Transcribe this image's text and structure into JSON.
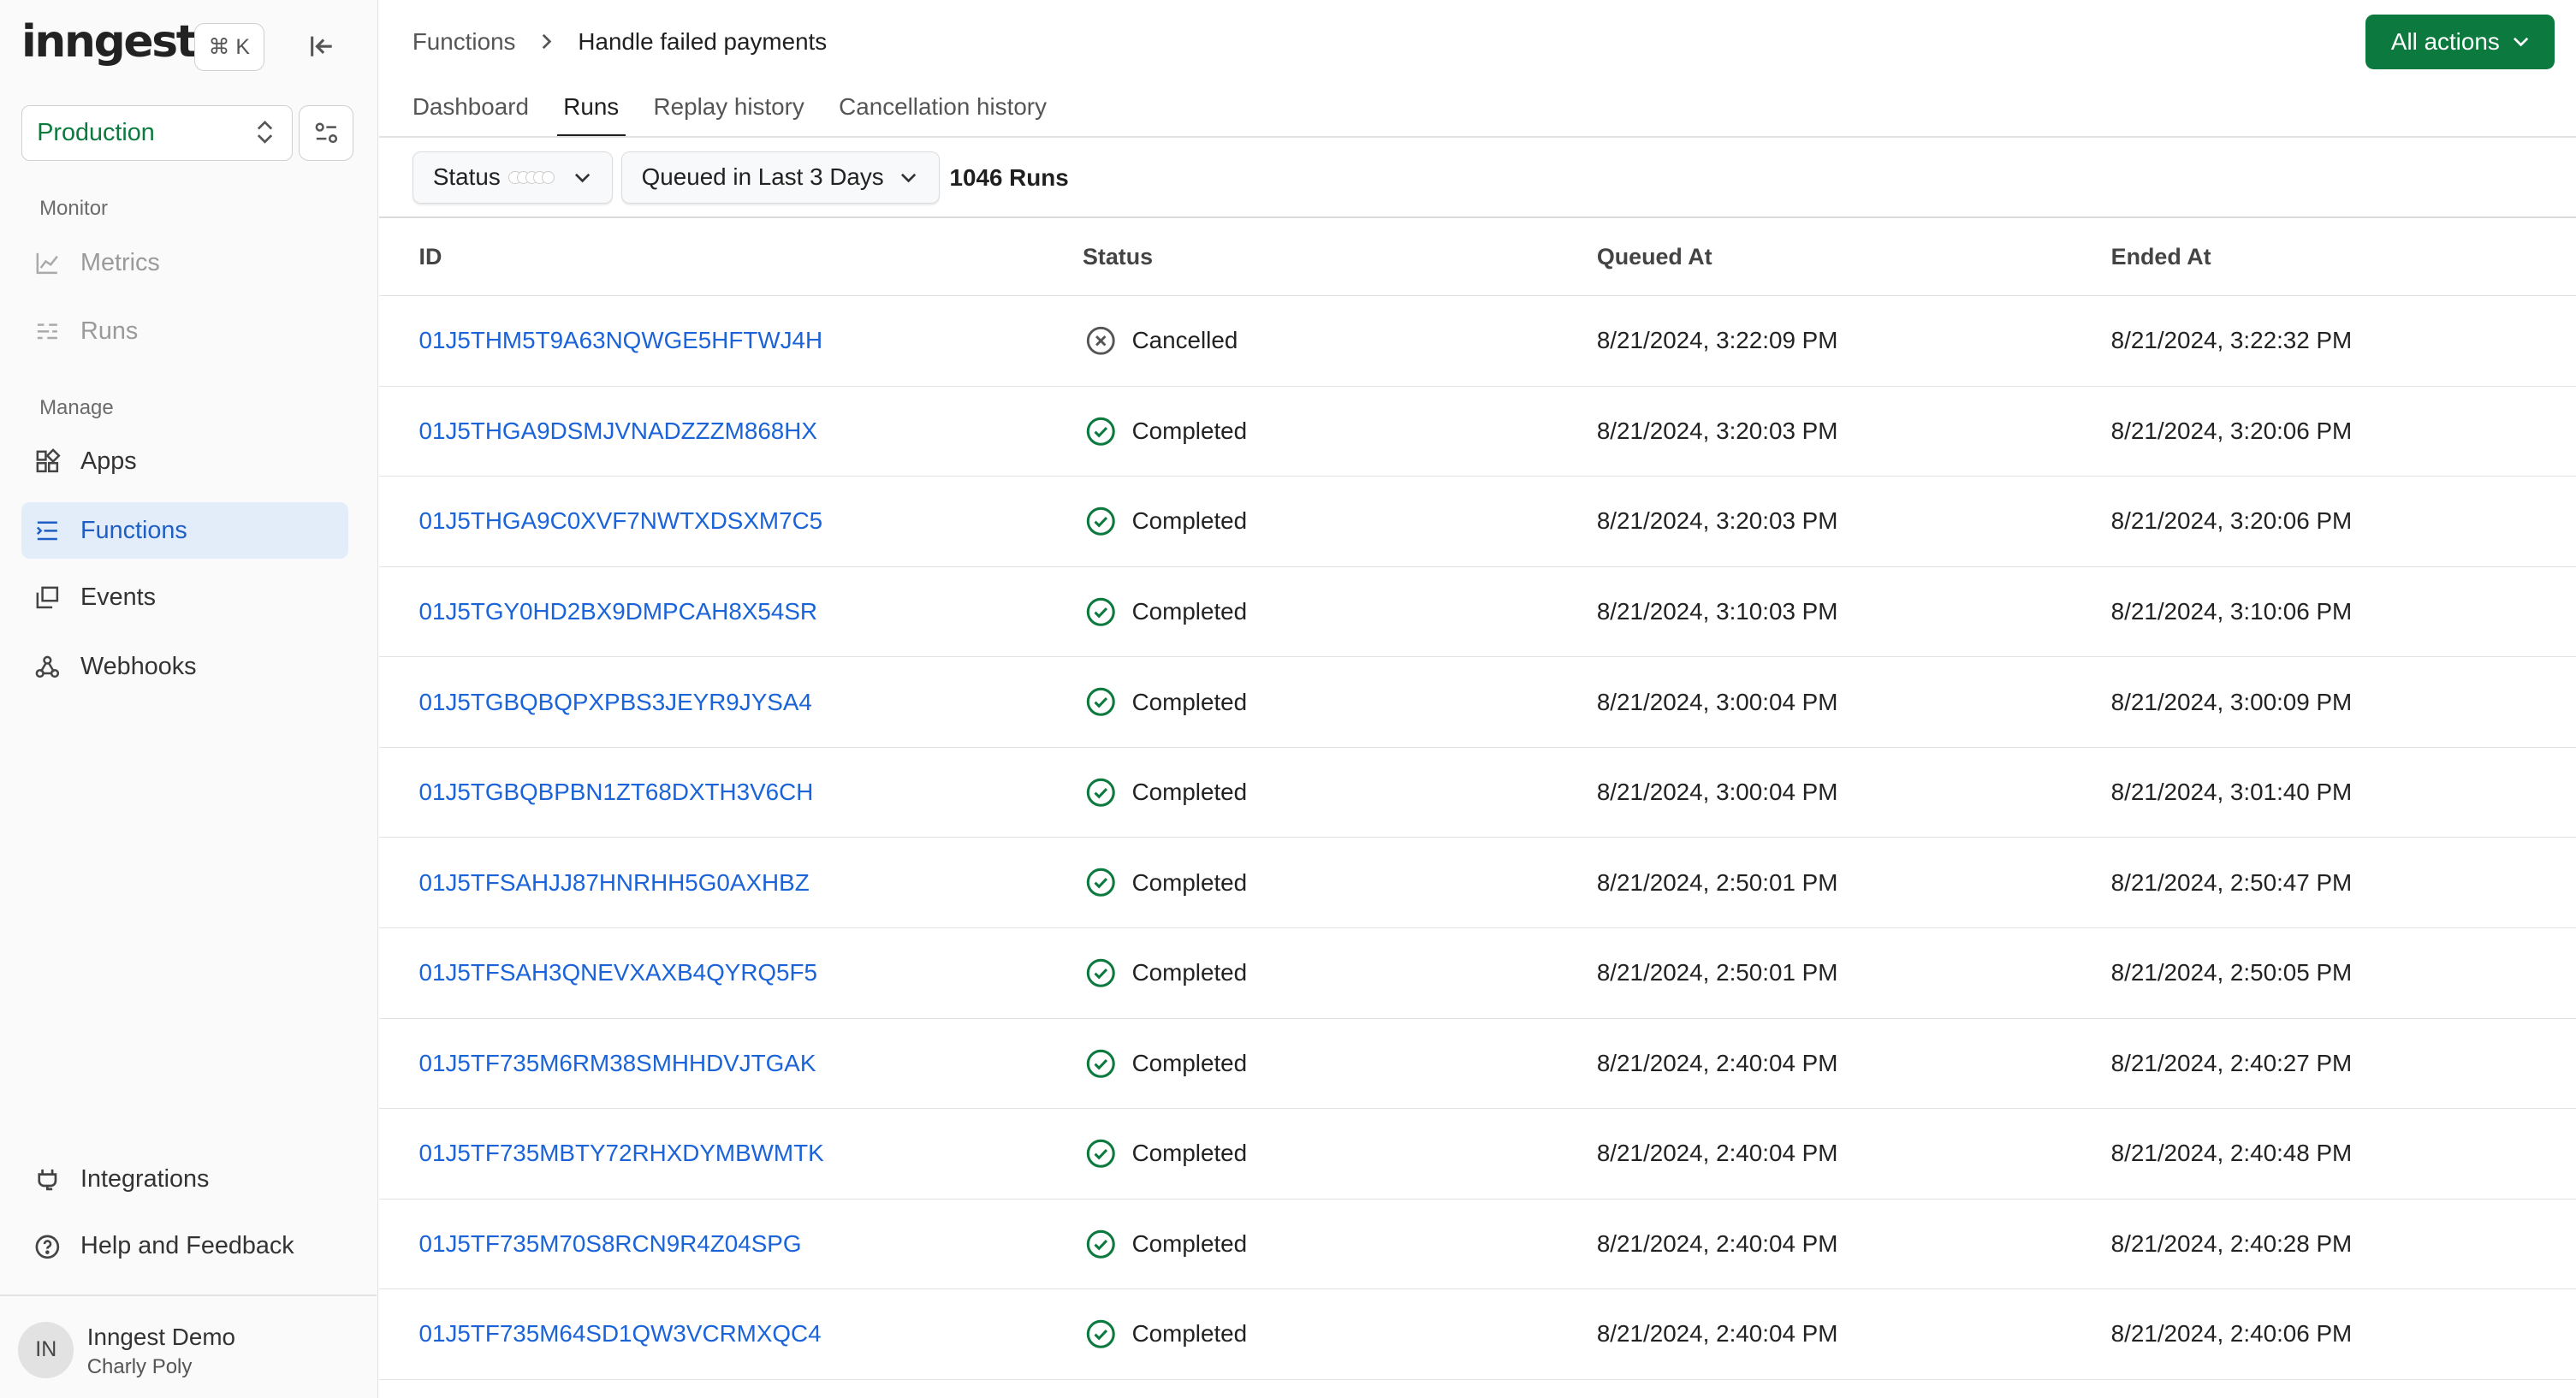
{
  "sidebar": {
    "logo": "inngest",
    "shortcut": "⌘ K",
    "environment": "Production",
    "sections": {
      "monitor": "Monitor",
      "manage": "Manage"
    },
    "items": [
      {
        "label": "Metrics",
        "icon": "chart-icon"
      },
      {
        "label": "Runs",
        "icon": "list-icon"
      },
      {
        "label": "Apps",
        "icon": "apps-icon"
      },
      {
        "label": "Functions",
        "icon": "functions-icon"
      },
      {
        "label": "Events",
        "icon": "events-icon"
      },
      {
        "label": "Webhooks",
        "icon": "webhook-icon"
      }
    ],
    "bottom": [
      {
        "label": "Integrations",
        "icon": "plug-icon"
      },
      {
        "label": "Help and Feedback",
        "icon": "help-icon"
      }
    ],
    "user": {
      "initials": "IN",
      "org": "Inngest Demo",
      "name": "Charly Poly"
    }
  },
  "header": {
    "breadcrumb": [
      "Functions",
      "Handle failed payments"
    ],
    "all_actions": "All actions",
    "tabs": [
      "Dashboard",
      "Runs",
      "Replay history",
      "Cancellation history"
    ],
    "active_tab": "Runs"
  },
  "filters": {
    "status_label": "Status",
    "time_label": "Queued in Last 3 Days",
    "run_count": "1046 Runs"
  },
  "colors": {
    "accent": "#0c7a3e",
    "link": "#1a63d8",
    "completed": "#0c7a3e",
    "cancelled": "#555555"
  },
  "table": {
    "columns": [
      "ID",
      "Status",
      "Queued At",
      "Ended At"
    ],
    "rows": [
      {
        "id": "01J5THM5T9A63NQWGE5HFTWJ4H",
        "status": "Cancelled",
        "queued": "8/21/2024, 3:22:09 PM",
        "ended": "8/21/2024, 3:22:32 PM"
      },
      {
        "id": "01J5THGA9DSMJVNADZZZM868HX",
        "status": "Completed",
        "queued": "8/21/2024, 3:20:03 PM",
        "ended": "8/21/2024, 3:20:06 PM"
      },
      {
        "id": "01J5THGA9C0XVF7NWTXDSXM7C5",
        "status": "Completed",
        "queued": "8/21/2024, 3:20:03 PM",
        "ended": "8/21/2024, 3:20:06 PM"
      },
      {
        "id": "01J5TGY0HD2BX9DMPCAH8X54SR",
        "status": "Completed",
        "queued": "8/21/2024, 3:10:03 PM",
        "ended": "8/21/2024, 3:10:06 PM"
      },
      {
        "id": "01J5TGBQBQPXPBS3JEYR9JYSA4",
        "status": "Completed",
        "queued": "8/21/2024, 3:00:04 PM",
        "ended": "8/21/2024, 3:00:09 PM"
      },
      {
        "id": "01J5TGBQBPBN1ZT68DXTH3V6CH",
        "status": "Completed",
        "queued": "8/21/2024, 3:00:04 PM",
        "ended": "8/21/2024, 3:01:40 PM"
      },
      {
        "id": "01J5TFSAHJJ87HNRHH5G0AXHBZ",
        "status": "Completed",
        "queued": "8/21/2024, 2:50:01 PM",
        "ended": "8/21/2024, 2:50:47 PM"
      },
      {
        "id": "01J5TFSAH3QNEVXAXB4QYRQ5F5",
        "status": "Completed",
        "queued": "8/21/2024, 2:50:01 PM",
        "ended": "8/21/2024, 2:50:05 PM"
      },
      {
        "id": "01J5TF735M6RM38SMHHDVJTGAK",
        "status": "Completed",
        "queued": "8/21/2024, 2:40:04 PM",
        "ended": "8/21/2024, 2:40:27 PM"
      },
      {
        "id": "01J5TF735MBTY72RHXDYMBWMTK",
        "status": "Completed",
        "queued": "8/21/2024, 2:40:04 PM",
        "ended": "8/21/2024, 2:40:48 PM"
      },
      {
        "id": "01J5TF735M70S8RCN9R4Z04SPG",
        "status": "Completed",
        "queued": "8/21/2024, 2:40:04 PM",
        "ended": "8/21/2024, 2:40:28 PM"
      },
      {
        "id": "01J5TF735M64SD1QW3VCRMXQC4",
        "status": "Completed",
        "queued": "8/21/2024, 2:40:04 PM",
        "ended": "8/21/2024, 2:40:06 PM"
      }
    ]
  }
}
